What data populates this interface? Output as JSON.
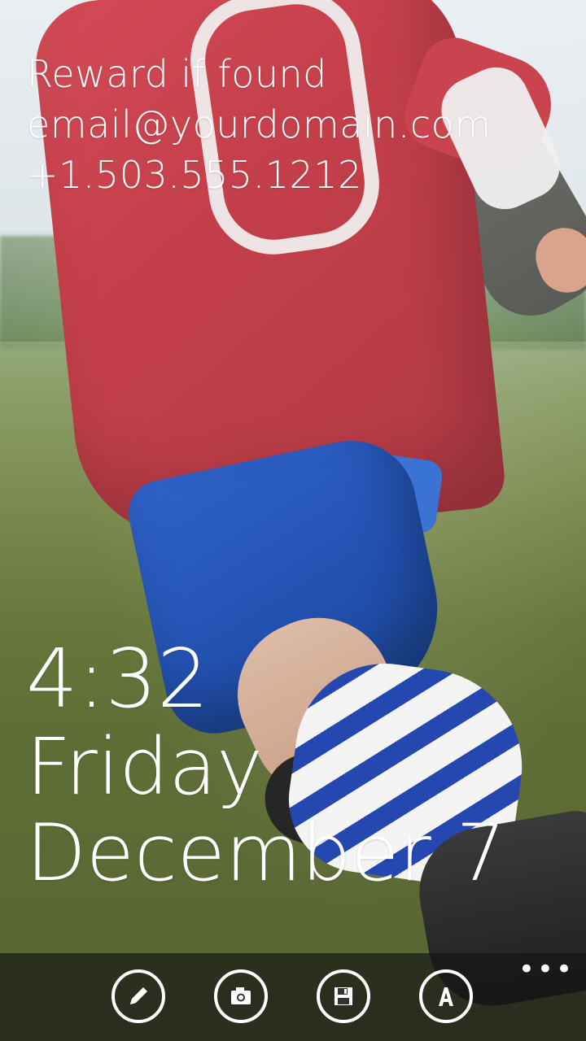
{
  "lockscreen": {
    "info_lines": [
      "Reward if found",
      "email@yourdomain.com",
      "+1.503.555.1212"
    ],
    "time": "4:32",
    "day": "Friday",
    "date": "December 7"
  },
  "appbar": {
    "buttons": [
      {
        "icon": "edit-pencil-icon"
      },
      {
        "icon": "camera-icon"
      },
      {
        "icon": "save-floppy-icon"
      },
      {
        "icon": "font-a-icon"
      }
    ],
    "more_glyph": "•••"
  },
  "colors": {
    "appbar_bg": "#141414",
    "text": "#ffffff"
  }
}
